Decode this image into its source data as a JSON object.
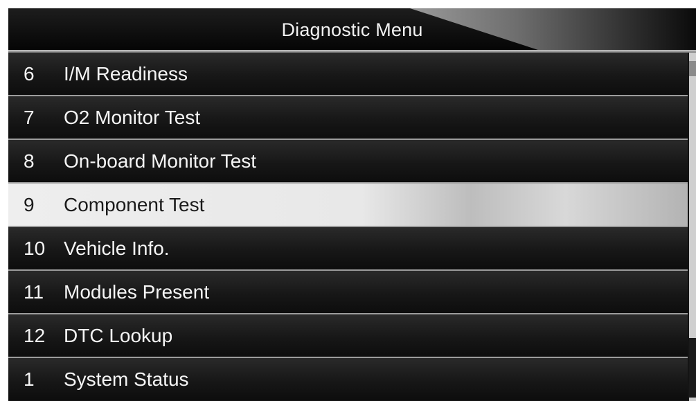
{
  "header": {
    "title": "Diagnostic Menu"
  },
  "menu": {
    "selected_index": 3,
    "items": [
      {
        "number": "6",
        "label": "I/M Readiness"
      },
      {
        "number": "7",
        "label": "O2 Monitor Test"
      },
      {
        "number": "8",
        "label": "On-board Monitor Test"
      },
      {
        "number": "9",
        "label": "Component Test"
      },
      {
        "number": "10",
        "label": "Vehicle Info."
      },
      {
        "number": "11",
        "label": "Modules Present"
      },
      {
        "number": "12",
        "label": "DTC Lookup"
      },
      {
        "number": "1",
        "label": "System Status"
      }
    ]
  },
  "colors": {
    "background": "#141414",
    "selected_row": "#e8e8e8",
    "text_light": "#f5f5f5",
    "text_dark": "#1a1a1a"
  }
}
